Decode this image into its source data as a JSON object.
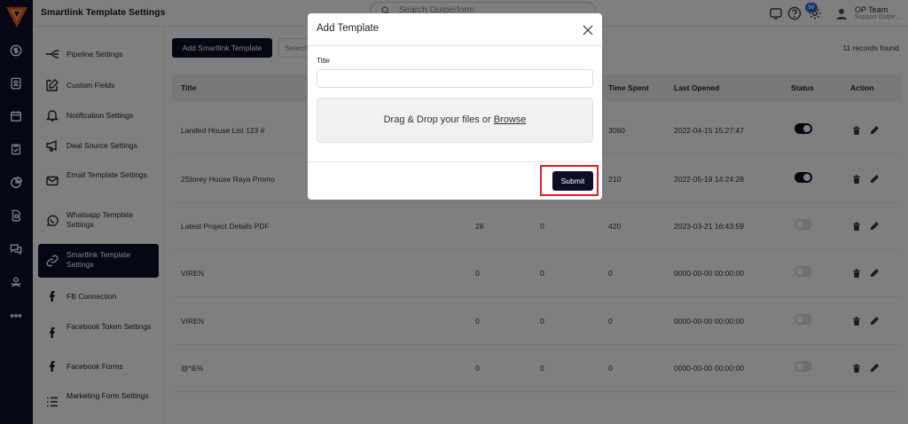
{
  "app": {
    "title": "Smartlink Template Settings",
    "search_placeholder": "Search Outperform",
    "notification_count": "50",
    "user": {
      "name": "OP Team",
      "role": "Support Outpe..."
    }
  },
  "rail_icons": [
    "dollar-icon",
    "contacts-icon",
    "calendar-icon",
    "clipboard-icon",
    "pie-chart-icon",
    "document-icon",
    "chat-icon",
    "team-icon",
    "more-icon"
  ],
  "sidebar": {
    "items": [
      {
        "label": "Pipeline Settings",
        "icon": "pipeline-icon"
      },
      {
        "label": "Custom Fields",
        "icon": "edit-square-icon"
      },
      {
        "label": "Notification Settings",
        "icon": "bell-icon"
      },
      {
        "label": "Deal Source Settings",
        "icon": "megaphone-icon"
      },
      {
        "label": "Email Template Settings",
        "icon": "mail-icon"
      },
      {
        "label": "Whatsapp Template Settings",
        "icon": "whatsapp-icon"
      },
      {
        "label": "Smartlink Template Settings",
        "icon": "link-icon"
      },
      {
        "label": "FB Connection",
        "icon": "facebook-icon"
      },
      {
        "label": "Facebook Token Settings",
        "icon": "facebook-icon"
      },
      {
        "label": "Facebook Forms",
        "icon": "facebook-icon"
      },
      {
        "label": "Marketing Form Settings",
        "icon": "list-icon"
      }
    ],
    "active_index": 6
  },
  "main": {
    "add_button_label": "Add Smartlink Template",
    "search_placeholder": "Search",
    "records_text": "11 records found.",
    "columns": [
      "Title",
      "Time Spent",
      "Last Opened",
      "Status",
      "Action"
    ],
    "rows": [
      {
        "title": "Landed House List 123 #",
        "c1": "",
        "c2": "",
        "time_spent": "3060",
        "last_opened": "2022-04-15 15:27:47",
        "status": true
      },
      {
        "title": "2Storey House Raya Promo",
        "c1": "",
        "c2": "",
        "time_spent": "210",
        "last_opened": "2022-05-19 14:24:28",
        "status": true
      },
      {
        "title": "Latest Project Details PDF",
        "c1": "28",
        "c2": "0",
        "time_spent": "420",
        "last_opened": "2023-03-21 16:43:59",
        "status": false
      },
      {
        "title": "VIREN",
        "c1": "0",
        "c2": "0",
        "time_spent": "0",
        "last_opened": "0000-00-00 00:00:00",
        "status": false
      },
      {
        "title": "VIREN",
        "c1": "0",
        "c2": "0",
        "time_spent": "0",
        "last_opened": "0000-00-00 00:00:00",
        "status": false
      },
      {
        "title": "@*&%",
        "c1": "0",
        "c2": "0",
        "time_spent": "0",
        "last_opened": "0000-00-00 00:00:00",
        "status": false
      }
    ]
  },
  "modal": {
    "title": "Add Template",
    "field_label": "Title",
    "title_value": "",
    "dropzone_text": "Drag & Drop your files or",
    "dropzone_link": "Browse",
    "submit_label": "Submit"
  },
  "colors": {
    "primary": "#0b0f2a",
    "highlight": "#e01b24",
    "badge": "#1f6feb"
  }
}
